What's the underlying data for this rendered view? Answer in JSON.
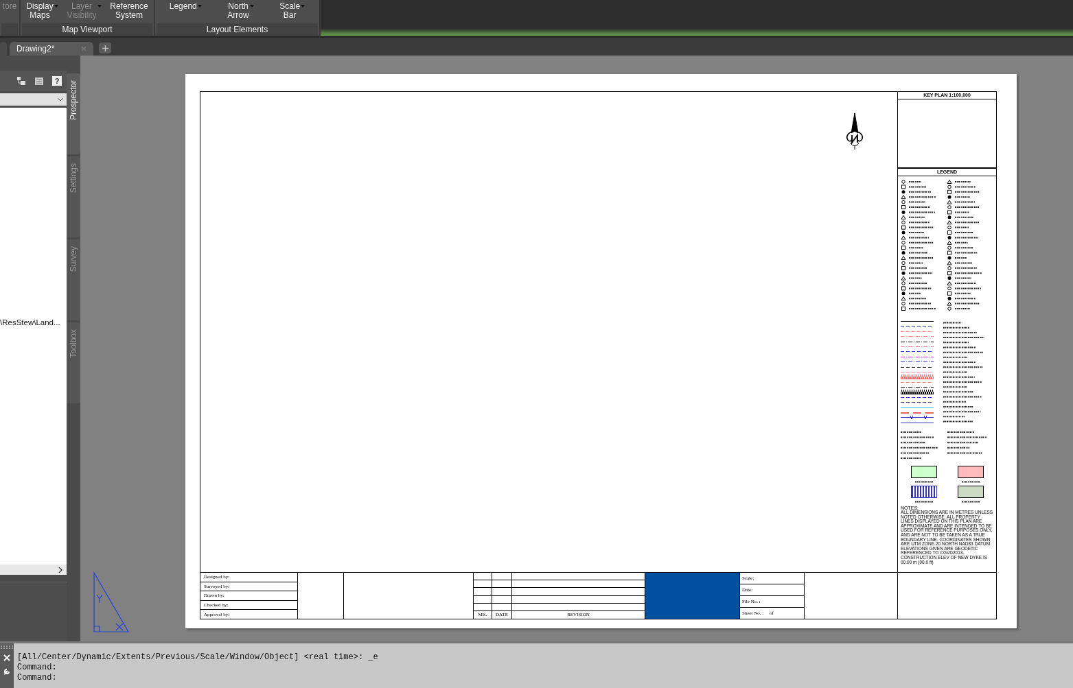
{
  "ribbon": {
    "panels": [
      {
        "buttons": [
          {
            "label": "tore",
            "disabled": true,
            "dropdown": false
          }
        ]
      },
      {
        "label": "Map Viewport",
        "buttons": [
          {
            "label": "Display Maps",
            "disabled": false,
            "dropdown": true
          },
          {
            "label": "Layer Visibility",
            "disabled": true,
            "dropdown": true
          },
          {
            "label": "Reference System",
            "disabled": false,
            "dropdown": false
          }
        ]
      },
      {
        "label": "Layout Elements",
        "buttons": [
          {
            "label": "Legend",
            "disabled": false,
            "dropdown": true
          },
          {
            "label": "North Arrow",
            "disabled": false,
            "dropdown": true
          },
          {
            "label": "Scale Bar",
            "disabled": false,
            "dropdown": true
          }
        ]
      }
    ]
  },
  "document_tabs": [
    {
      "label": "Drawing2*",
      "selected": true
    }
  ],
  "palette": {
    "help_button": "?",
    "tree_item": "\\ResStew\\Land...",
    "side_tabs": [
      {
        "label": "Prospector",
        "selected": true
      },
      {
        "label": "Settings",
        "selected": false
      },
      {
        "label": "Survey",
        "selected": false
      },
      {
        "label": "Toolbox",
        "selected": false
      }
    ]
  },
  "sheet": {
    "key_plan_title": "KEY PLAN 1:100,000",
    "legend_title": "LEGEND",
    "line_types": [
      {
        "color": "#000000",
        "kind": "solid"
      },
      {
        "color": "#333399",
        "kind": "dashed"
      },
      {
        "color": "#ff8080",
        "kind": "dashed"
      },
      {
        "color": "#ff9999",
        "kind": "dashdot"
      },
      {
        "color": "#000000",
        "kind": "dashdot"
      },
      {
        "color": "#ff8080",
        "kind": "dashdot"
      },
      {
        "color": "#3333cc",
        "kind": "dashed"
      },
      {
        "color": "#ff00ff",
        "kind": "dashdot"
      },
      {
        "color": "#3333cc",
        "kind": "dashdot"
      },
      {
        "color": "#000000",
        "kind": "dashed"
      },
      {
        "color": "#ff8080",
        "kind": "dashed"
      },
      {
        "color": "#ff6666",
        "kind": "teeth"
      },
      {
        "color": "#ff8080",
        "kind": "dashed"
      },
      {
        "color": "#000000",
        "kind": "dashdot"
      },
      {
        "color": "#000000",
        "kind": "teeth"
      },
      {
        "color": "#3333cc",
        "kind": "dashed"
      },
      {
        "color": "#333366",
        "kind": "dashed"
      },
      {
        "color": "#33cccc",
        "kind": "solid"
      },
      {
        "color": "#e06666",
        "kind": "longdash"
      },
      {
        "color": "#3333cc",
        "kind": "ditch"
      },
      {
        "color": "#3333cc",
        "kind": "solid"
      }
    ],
    "swatches": [
      {
        "color": "#ccffcc",
        "kind": "plain"
      },
      {
        "color": "#ffbbbb",
        "kind": "plain"
      },
      {
        "color": "#3333cc",
        "kind": "dotted"
      },
      {
        "color": "#ccdcc4",
        "kind": "plain"
      }
    ],
    "notes_title": "NOTES:",
    "notes": "ALL DIMENSIONS ARE IN METRES UNLESS NOTED OTHERWISE. ALL PROPERTY LINES DISPLAYED ON THIS PLAN ARE APPROXIMATE AND ARE INTENDED TO BE USED FOR REFERENCE PURPOSES ONLY, AND ARE NOT TO BE TAKEN AS A TRUE BOUNDARY LINE. COORDINATES SHOWN ARE UTM ZONE 20 NORTH NAD83 DATUM. ELEVATIONS GIVEN ARE GEODETIC REFERENCED TO CGVD2013. CONSTRUCTION ELEV OF NEW DYKE IS 00.00 m (00.0 ft)",
    "signoffs": [
      "Designed by:",
      "Surveyed by:",
      "Drawn by:",
      "Checked by:",
      "Approval by:"
    ],
    "revision_headers": [
      "MK.",
      "DATE",
      "REVISION"
    ],
    "sheet_info": [
      "Scale:",
      "Date:",
      "File No. :",
      "Sheet No. :     of"
    ]
  },
  "command_line": [
    "[All/Center/Dynamic/Extents/Previous/Scale/Window/Object] <real time>: _e",
    "Command:",
    "Command:"
  ]
}
